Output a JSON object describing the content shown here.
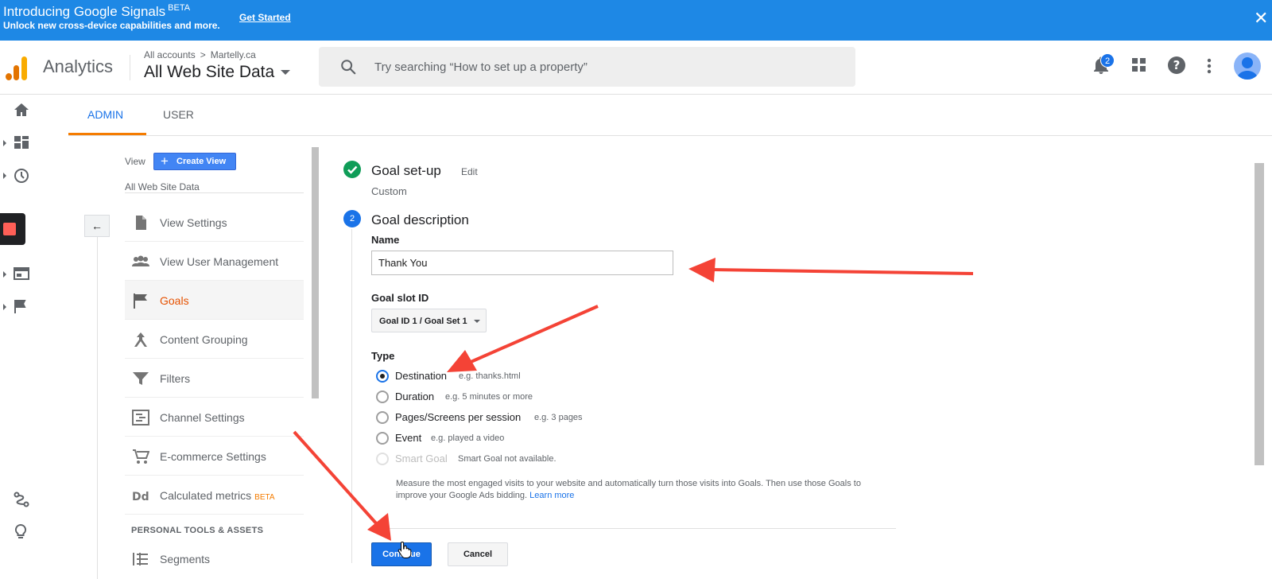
{
  "banner": {
    "title": "Introducing Google Signals",
    "title_badge": "BETA",
    "subtitle": "Unlock new cross-device capabilities and more.",
    "cta": "Get Started",
    "close": "✕"
  },
  "header": {
    "brand": "Analytics",
    "breadcrumb_root": "All accounts",
    "breadcrumb_sep": ">",
    "breadcrumb_account": "Martelly.ca",
    "view_name": "All Web Site Data",
    "search_placeholder": "Try searching “How to set up a property”",
    "notification_count": "2",
    "logo_colors": [
      "#f9ab00",
      "#e37400",
      "#e37400"
    ]
  },
  "tabs": [
    {
      "label": "ADMIN",
      "active": true
    },
    {
      "label": "USER",
      "active": false
    }
  ],
  "admin_pane": {
    "view_label": "View",
    "create_view": "Create View",
    "view_name": "All Web Site Data",
    "back_icon": "←",
    "menu": [
      {
        "label": "View Settings",
        "icon": "document-icon"
      },
      {
        "label": "View User Management",
        "icon": "people-icon"
      },
      {
        "label": "Goals",
        "icon": "flag-icon",
        "selected": true
      },
      {
        "label": "Content Grouping",
        "icon": "grouping-icon"
      },
      {
        "label": "Filters",
        "icon": "filter-icon"
      },
      {
        "label": "Channel Settings",
        "icon": "channel-icon"
      },
      {
        "label": "E-commerce Settings",
        "icon": "cart-icon"
      },
      {
        "label": "Calculated metrics",
        "icon": "dd-icon",
        "badge": "BETA"
      }
    ],
    "section_heading": "PERSONAL TOOLS & ASSETS",
    "segments": "Segments"
  },
  "goal_form": {
    "setup_title": "Goal set-up",
    "setup_edit": "Edit",
    "setup_value": "Custom",
    "step_number": "2",
    "desc_title": "Goal description",
    "name_label": "Name",
    "name_value": "Thank You",
    "slot_label": "Goal slot ID",
    "slot_value": "Goal ID 1 / Goal Set 1",
    "type_label": "Type",
    "types": [
      {
        "label": "Destination",
        "hint": "e.g. thanks.html",
        "selected": true
      },
      {
        "label": "Duration",
        "hint": "e.g. 5 minutes or more"
      },
      {
        "label": "Pages/Screens per session",
        "hint": "e.g. 3 pages"
      },
      {
        "label": "Event",
        "hint": "e.g. played a video"
      },
      {
        "label": "Smart Goal",
        "hint": "Smart Goal not available.",
        "disabled": true
      }
    ],
    "smart_desc": "Measure the most engaged visits to your website and automatically turn those visits into Goals. Then use those Goals to improve your Google Ads bidding.",
    "learn_more": "Learn more",
    "continue": "Continue",
    "cancel": "Cancel"
  },
  "colors": {
    "banner": "#1e88e5",
    "accent": "#1a73e8",
    "tab_indicator": "#f57c00",
    "selected_menu": "#e65100",
    "success": "#0f9d58",
    "annotation_arrow": "#f44336"
  }
}
